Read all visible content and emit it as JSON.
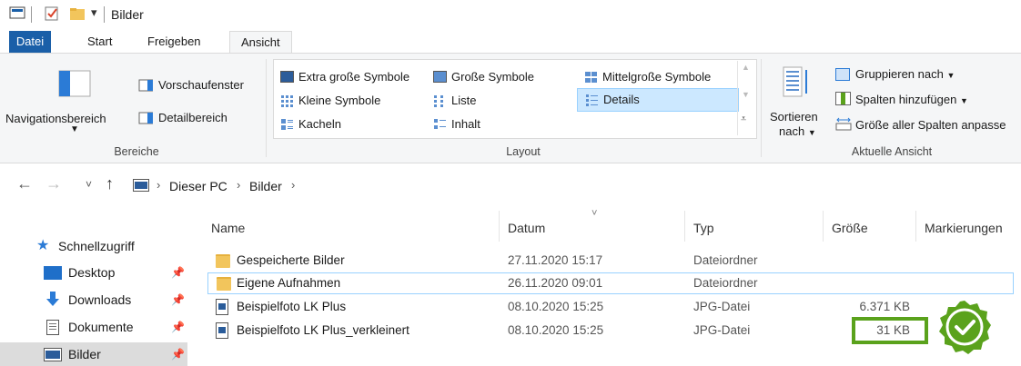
{
  "window": {
    "title": "Bilder"
  },
  "tabs": [
    {
      "label": "Datei"
    },
    {
      "label": "Start"
    },
    {
      "label": "Freigeben"
    },
    {
      "label": "Ansicht"
    }
  ],
  "ribbon": {
    "bereiche": {
      "navigationsbereich": "Navigationsbereich",
      "vorschaufenster": "Vorschaufenster",
      "detailbereich": "Detailbereich",
      "label": "Bereiche"
    },
    "layout": {
      "items": [
        "Extra große Symbole",
        "Große Symbole",
        "Mittelgroße Symbole",
        "Kleine Symbole",
        "Liste",
        "Details",
        "Kacheln",
        "Inhalt"
      ],
      "selected": "Details",
      "label": "Layout"
    },
    "aktuelle_ansicht": {
      "sortieren_1": "Sortieren",
      "sortieren_2": "nach",
      "gruppieren": "Gruppieren nach",
      "spalten_hinzufuegen": "Spalten hinzufügen",
      "groesse_spalten": "Größe aller Spalten anpasse",
      "label": "Aktuelle Ansicht"
    }
  },
  "address": {
    "crumbs": [
      "Dieser PC",
      "Bilder"
    ]
  },
  "nav_pane": {
    "quick_access": "Schnellzugriff",
    "items": [
      {
        "label": "Desktop"
      },
      {
        "label": "Downloads"
      },
      {
        "label": "Dokumente"
      },
      {
        "label": "Bilder"
      }
    ]
  },
  "columns": {
    "name": "Name",
    "datum": "Datum",
    "typ": "Typ",
    "groesse": "Größe",
    "markierungen": "Markierungen"
  },
  "files": [
    {
      "name": "Gespeicherte Bilder",
      "date": "27.11.2020 15:17",
      "type": "Dateiordner",
      "size": "",
      "kind": "folder"
    },
    {
      "name": "Eigene Aufnahmen",
      "date": "26.11.2020 09:01",
      "type": "Dateiordner",
      "size": "",
      "kind": "folder"
    },
    {
      "name": "Beispielfoto LK Plus",
      "date": "08.10.2020 15:25",
      "type": "JPG-Datei",
      "size": "6.371 KB",
      "kind": "jpg"
    },
    {
      "name": "Beispielfoto LK Plus_verkleinert",
      "date": "08.10.2020 15:25",
      "type": "JPG-Datei",
      "size": "31 KB",
      "kind": "jpg"
    }
  ],
  "colors": {
    "accent": "#1a5fa8",
    "highlight": "#5aa21c",
    "selected_row": "#cce8ff"
  }
}
